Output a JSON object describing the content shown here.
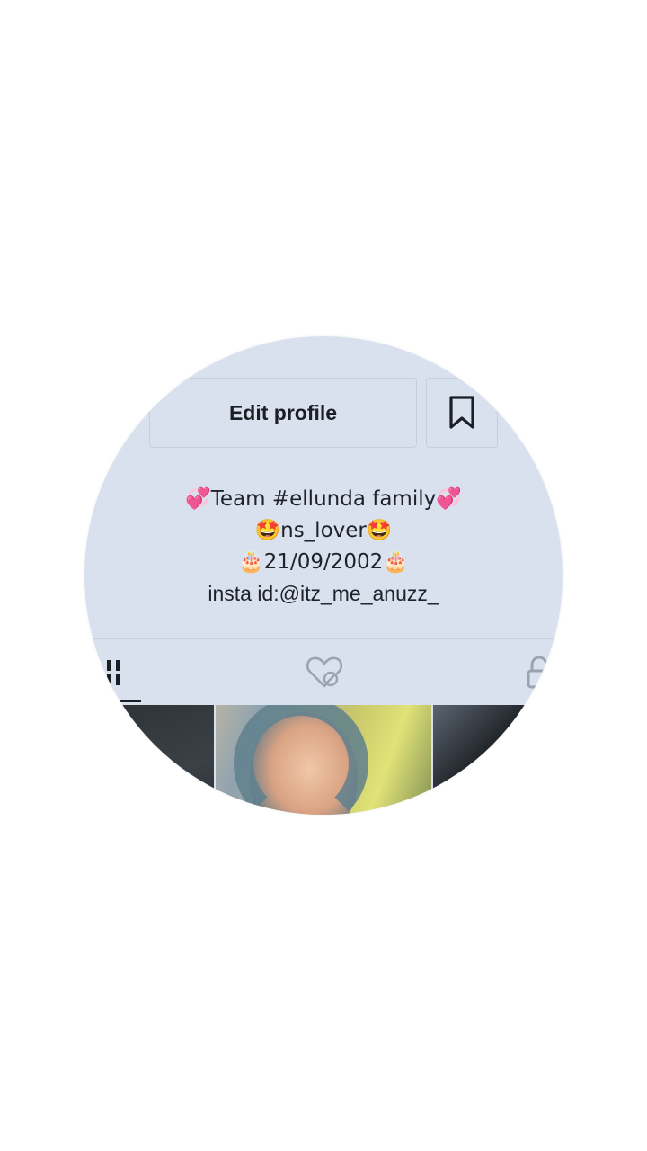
{
  "profile": {
    "edit_profile_label": "Edit profile",
    "bio_lines": [
      "💞Team #ellunda family💞",
      "🤩ns_lover🤩",
      "🎂21/09/2002🎂",
      "insta id:@itz_me_anuzz_"
    ]
  },
  "tabs": [
    {
      "name": "videos",
      "icon": "grid-icon",
      "active": true
    },
    {
      "name": "liked",
      "icon": "hidden-heart-icon",
      "active": false
    },
    {
      "name": "private",
      "icon": "lock-icon",
      "active": false
    }
  ],
  "colors": {
    "lens_background": "#d9e1ee",
    "text": "#1f222b",
    "border": "#c6cede"
  }
}
